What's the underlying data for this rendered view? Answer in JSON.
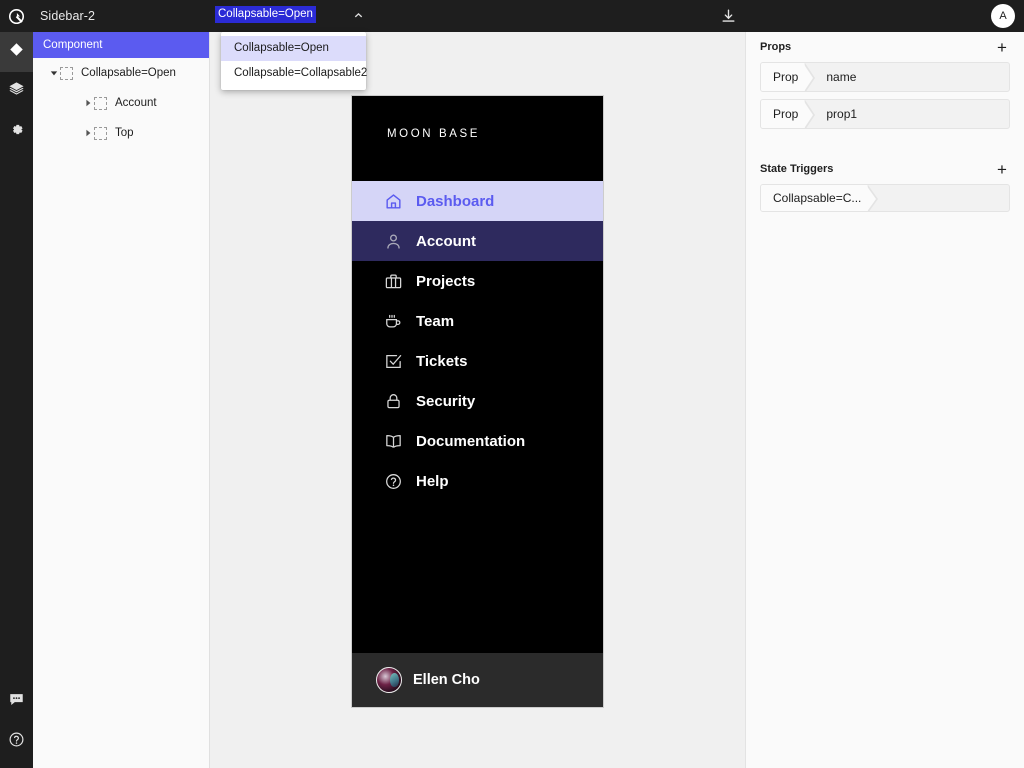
{
  "topbar": {
    "logo_icon": "app-logo-icon",
    "document_title": "Sidebar-2",
    "variant_selected": "Collapsable=Open",
    "caret_icon": "chevron-up-icon",
    "download_icon": "download-icon",
    "avatar_initial": "A"
  },
  "dropdown": {
    "items": [
      {
        "label": "Collapsable=Open",
        "selected": true
      },
      {
        "label": "Collapsable=Collapsable2",
        "selected": false
      }
    ]
  },
  "rail": {
    "items": [
      {
        "icon": "diamond-icon",
        "active": true
      },
      {
        "icon": "layers-icon",
        "active": false
      },
      {
        "icon": "gear-icon",
        "active": false
      }
    ],
    "bottom_items": [
      {
        "icon": "chat-bubble-icon"
      },
      {
        "icon": "help-circle-icon"
      }
    ]
  },
  "tree": {
    "header": "Component",
    "nodes": [
      {
        "label": "Collapsable=Open",
        "depth": 0,
        "expanded": true
      },
      {
        "label": "Account",
        "depth": 1,
        "expanded": false
      },
      {
        "label": "Top",
        "depth": 1,
        "expanded": false
      }
    ]
  },
  "preview": {
    "brand": "MOON BASE",
    "nav": [
      {
        "label": "Dashboard",
        "icon": "home-icon",
        "state": "dash"
      },
      {
        "label": "Account",
        "icon": "user-icon",
        "state": "acct"
      },
      {
        "label": "Projects",
        "icon": "briefcase-icon",
        "state": ""
      },
      {
        "label": "Team",
        "icon": "coffee-cup-icon",
        "state": ""
      },
      {
        "label": "Tickets",
        "icon": "check-square-icon",
        "state": ""
      },
      {
        "label": "Security",
        "icon": "lock-icon",
        "state": ""
      },
      {
        "label": "Documentation",
        "icon": "book-icon",
        "state": ""
      },
      {
        "label": "Help",
        "icon": "help-circle-icon",
        "state": ""
      }
    ],
    "user_name": "Ellen Cho"
  },
  "rpanel": {
    "props_title": "Props",
    "props_add_label": "+",
    "props": [
      {
        "key": "Prop",
        "value": "name"
      },
      {
        "key": "Prop",
        "value": "prop1"
      }
    ],
    "triggers_title": "State Triggers",
    "triggers_add_label": "+",
    "triggers": [
      {
        "label": "Collapsable=C..."
      }
    ]
  },
  "colors": {
    "accent": "#5b5bf0",
    "select_blue": "#2b2bd6",
    "dash_bg": "#d5d5f7",
    "acct_bg": "#2e2a5e",
    "topbar_bg": "#1e1e1e"
  }
}
